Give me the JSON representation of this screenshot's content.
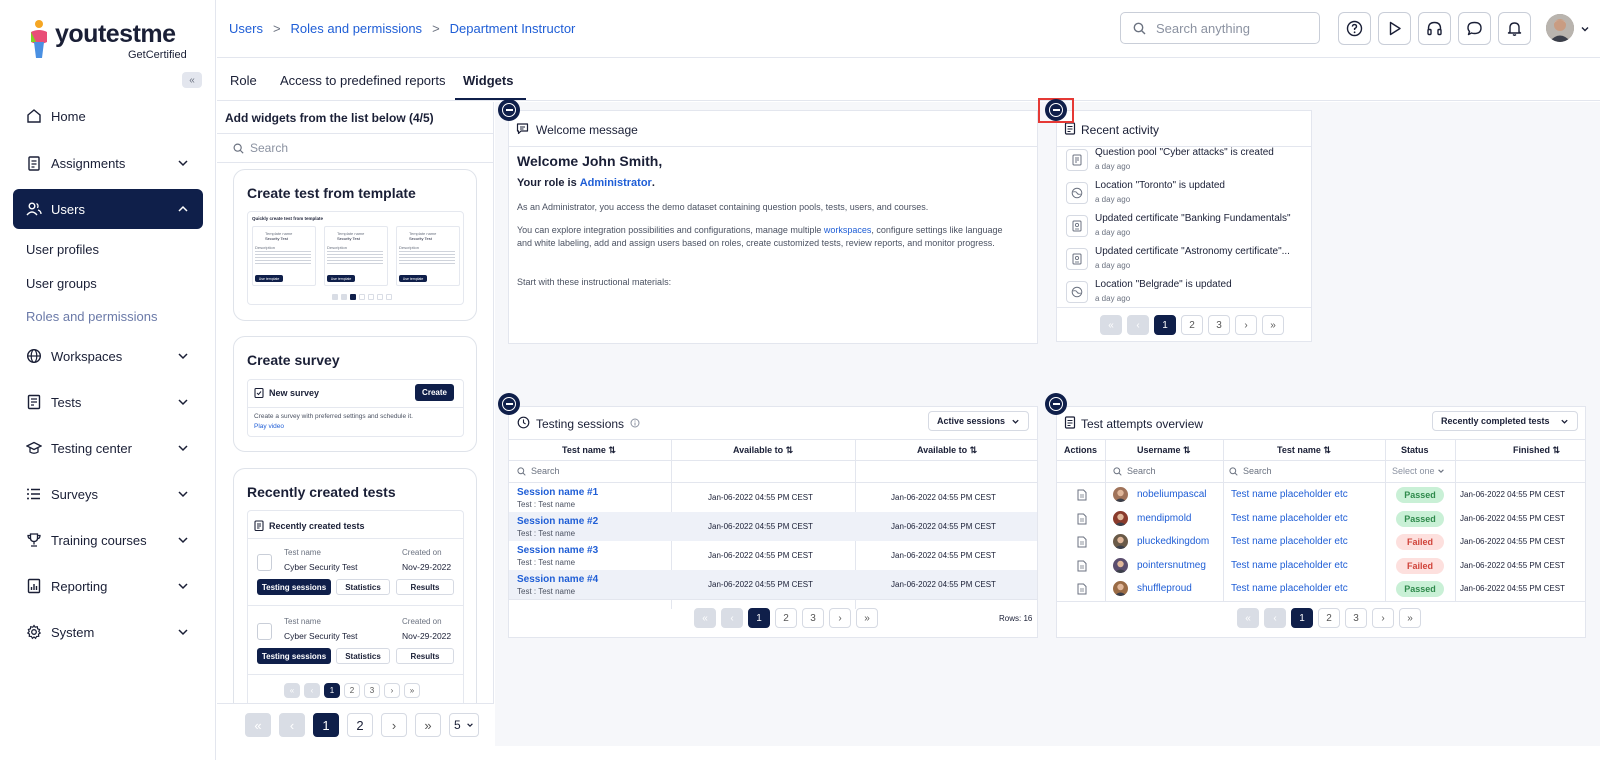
{
  "brand": {
    "name": "youtestme",
    "tagline": "GetCertified"
  },
  "sidebar": {
    "items": [
      {
        "label": "Home"
      },
      {
        "label": "Assignments"
      },
      {
        "label": "Users"
      },
      {
        "label": "Workspaces"
      },
      {
        "label": "Tests"
      },
      {
        "label": "Testing center"
      },
      {
        "label": "Surveys"
      },
      {
        "label": "Training courses"
      },
      {
        "label": "Reporting"
      },
      {
        "label": "System"
      }
    ],
    "subitems": [
      {
        "label": "User profiles"
      },
      {
        "label": "User groups"
      },
      {
        "label": "Roles and permissions"
      }
    ]
  },
  "breadcrumb": {
    "items": [
      "Users",
      "Roles and permissions",
      "Department Instructor"
    ],
    "sep": ">"
  },
  "search": {
    "placeholder": "Search anything"
  },
  "tabs": [
    "Role",
    "Access to predefined reports",
    "Widgets"
  ],
  "left_panel": {
    "title": "Add widgets from the list below (4/5)",
    "search_placeholder": "Search",
    "cards": {
      "template": {
        "title": "Create test from template",
        "preview_heading": "Quickly create test from template",
        "template_label": "Template name",
        "template_value": "Security Test",
        "description_label": "Description",
        "use_button": "Use template"
      },
      "survey": {
        "title": "Create survey",
        "widget_title": "New survey",
        "create_button": "Create",
        "description": "Create a survey with preferred settings and schedule it.",
        "play_link": "Play video"
      },
      "recent": {
        "title": "Recently created tests",
        "widget_title": "Recently created tests",
        "rows": [
          {
            "name_label": "Test name",
            "name": "Cyber Security Test",
            "date_label": "Created on",
            "date": "Nov-29-2022"
          },
          {
            "name_label": "Test name",
            "name": "Cyber Security Test",
            "date_label": "Created on",
            "date": "Nov-29-2022"
          }
        ],
        "buttons": [
          "Testing sessions",
          "Statistics",
          "Results"
        ],
        "pages": [
          "1",
          "2",
          "3"
        ]
      }
    },
    "pager": {
      "pages": [
        "1",
        "2"
      ],
      "page_size": "5"
    }
  },
  "welcome": {
    "header": "Welcome message",
    "greeting": "Welcome John Smith,",
    "role_prefix": "Your role is",
    "role": "Administrator",
    "role_suffix": ".",
    "p1": "As an Administrator, you access the demo dataset containing question pools, tests, users, and courses.",
    "p2a": "You can explore integration possibilities and configurations, manage multiple",
    "p2link": "workspaces",
    "p2b": ", configure settings like language and white labeling, add and assign users based on roles, create customized tests, review reports, and monitor progress.",
    "p3": "Start with these instructional materials:"
  },
  "activity": {
    "header": "Recent activity",
    "items": [
      {
        "text": "Question pool \"Cyber attacks\" is created",
        "time": "a day ago",
        "icon": "question-pool-icon"
      },
      {
        "text": "Location \"Toronto\" is updated",
        "time": "a day ago",
        "icon": "globe-icon"
      },
      {
        "text": "Updated certificate \"Banking Fundamentals\"",
        "time": "a day ago",
        "icon": "certificate-icon"
      },
      {
        "text": "Updated certificate \"Astronomy certificate\"...",
        "time": "a day ago",
        "icon": "certificate-icon"
      },
      {
        "text": "Location \"Belgrade\" is updated",
        "time": "a day ago",
        "icon": "globe-icon"
      }
    ],
    "pages": [
      "1",
      "2",
      "3"
    ]
  },
  "sessions": {
    "header": "Testing sessions",
    "filter": "Active sessions",
    "columns": [
      "Test name ⇅",
      "Available to ⇅",
      "Available to ⇅"
    ],
    "search_placeholder": "Search",
    "rows": [
      {
        "name": "Session name #1",
        "sub": "Test : Test name",
        "from": "Jan-06-2022 04:55 PM CEST",
        "to": "Jan-06-2022 04:55 PM CEST"
      },
      {
        "name": "Session name #2",
        "sub": "Test : Test name",
        "from": "Jan-06-2022 04:55 PM CEST",
        "to": "Jan-06-2022 04:55 PM CEST"
      },
      {
        "name": "Session name #3",
        "sub": "Test : Test name",
        "from": "Jan-06-2022 04:55 PM CEST",
        "to": "Jan-06-2022 04:55 PM CEST"
      },
      {
        "name": "Session name #4",
        "sub": "Test : Test name",
        "from": "Jan-06-2022 04:55 PM CEST",
        "to": "Jan-06-2022 04:55 PM CEST"
      }
    ],
    "pages": [
      "1",
      "2",
      "3"
    ],
    "rows_label": "Rows: 16"
  },
  "attempts": {
    "header": "Test attempts overview",
    "filter": "Recently completed tests",
    "columns": [
      "Actions",
      "Username ⇅",
      "Test name ⇅",
      "Status",
      "Finished ⇅"
    ],
    "search_placeholder": "Search",
    "status_placeholder": "Select one",
    "rows": [
      {
        "user": "nobeliumpascal",
        "test": "Test name placeholder etc",
        "status": "Passed",
        "finished": "Jan-06-2022 04:55 PM CEST",
        "avatar": "#a0735a"
      },
      {
        "user": "mendipmold",
        "test": "Test name placeholder etc",
        "status": "Passed",
        "finished": "Jan-06-2022 04:55 PM CEST",
        "avatar": "#8a3b2c"
      },
      {
        "user": "pluckedkingdom",
        "test": "Test name placeholder etc",
        "status": "Failed",
        "finished": "Jan-06-2022 04:55 PM CEST",
        "avatar": "#6a5a48"
      },
      {
        "user": "pointersnutmeg",
        "test": "Test name placeholder etc",
        "status": "Failed",
        "finished": "Jan-06-2022 04:55 PM CEST",
        "avatar": "#5b4d6e"
      },
      {
        "user": "shuffleproud",
        "test": "Test name placeholder etc",
        "status": "Passed",
        "finished": "Jan-06-2022 04:55 PM CEST",
        "avatar": "#9a6b45"
      }
    ],
    "pages": [
      "1",
      "2",
      "3"
    ]
  },
  "colors": {
    "navy": "#0f1f4a",
    "link": "#1f5ed6",
    "passed_bg": "#c9f0d6",
    "passed_fg": "#2f8a4c",
    "failed_bg": "#fde0de",
    "failed_fg": "#d0433a",
    "highlight": "#e53935"
  }
}
